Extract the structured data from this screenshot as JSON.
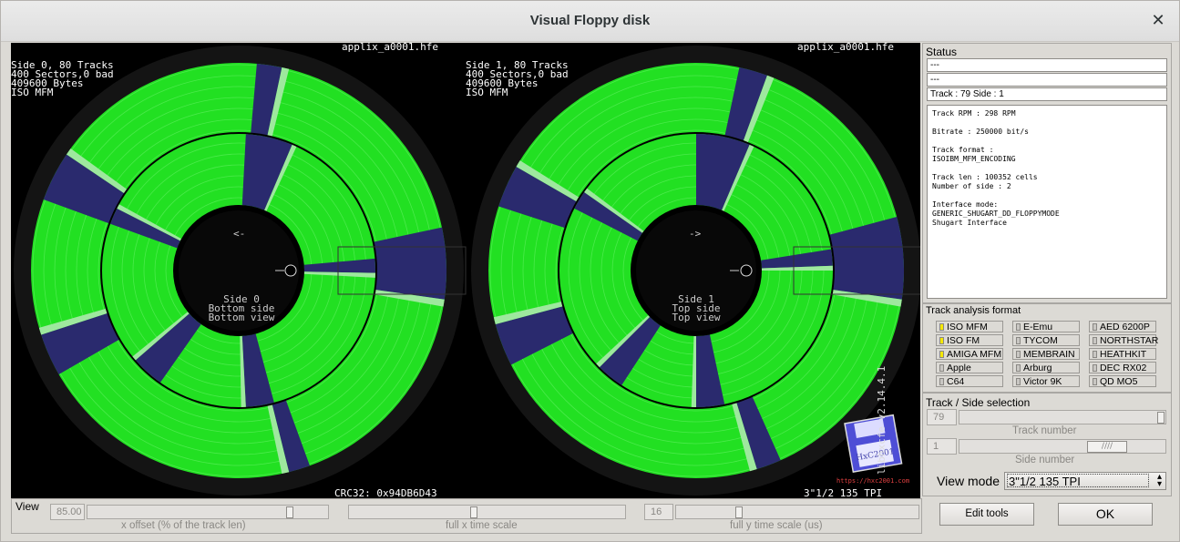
{
  "window": {
    "title": "Visual Floppy disk"
  },
  "side0": {
    "info": [
      "Side 0, 80 Tracks",
      "400 Sectors,0 bad",
      "409600 Bytes",
      "ISO MFM"
    ],
    "filename": "applix_a0001.hfe",
    "arrow": "<-",
    "center": [
      "Side 0",
      "Bottom side",
      "Bottom view"
    ]
  },
  "side1": {
    "info": [
      "Side 1, 80 Tracks",
      "400 Sectors,0 bad",
      "409600 Bytes",
      "ISO MFM"
    ],
    "filename": "applix_a0001.hfe",
    "arrow": "->",
    "center": [
      "Side 1",
      "Top side",
      "Top view"
    ]
  },
  "footer": {
    "crc": "CRC32: 0x94DB6D43",
    "format": "3\"1/2 135 TPI",
    "version": "libhxcfe v2.14.4.1",
    "url": "https://hxc2001.com",
    "logo_text": "HxC2001"
  },
  "status": {
    "label": "Status",
    "line1": "---",
    "line2": "---",
    "track_side": "Track : 79 Side : 1",
    "details": "Track RPM : 298 RPM\n\nBitrate : 250000 bit/s\n\nTrack format :\nISOIBM_MFM_ENCODING\n\nTrack len : 100352 cells\nNumber of side : 2\n\nInterface mode:\nGENERIC_SHUGART_DD_FLOPPYMODE\nShugart Interface"
  },
  "analysis": {
    "label": "Track analysis format",
    "formats": [
      {
        "name": "ISO MFM",
        "on": true
      },
      {
        "name": "E-Emu",
        "on": false
      },
      {
        "name": "AED 6200P",
        "on": false
      },
      {
        "name": "ISO FM",
        "on": true
      },
      {
        "name": "TYCOM",
        "on": false
      },
      {
        "name": "NORTHSTAR",
        "on": false
      },
      {
        "name": "AMIGA MFM",
        "on": true
      },
      {
        "name": "MEMBRAIN",
        "on": false
      },
      {
        "name": "HEATHKIT",
        "on": false
      },
      {
        "name": "Apple",
        "on": false
      },
      {
        "name": "Arburg",
        "on": false
      },
      {
        "name": "DEC RX02",
        "on": false
      },
      {
        "name": "C64",
        "on": false
      },
      {
        "name": "Victor 9K",
        "on": false
      },
      {
        "name": "QD MO5",
        "on": false
      }
    ]
  },
  "selection": {
    "label": "Track / Side selection",
    "track_value": "79",
    "track_label": "Track number",
    "side_value": "1",
    "side_label": "Side number",
    "view_mode_label": "View mode",
    "view_mode_value": "3\"1/2 135 TPI"
  },
  "view": {
    "label": "View",
    "x_offset_value": "85.00",
    "x_offset_label": "x offset (% of the track len)",
    "x_scale_label": "full x time scale",
    "y_scale_value": "16",
    "y_scale_label": "full y time scale (us)",
    "x_offset_level": 0.85,
    "x_scale_level": 0.45,
    "y_scale_level": 0.25
  },
  "buttons": {
    "edit_tools": "Edit tools",
    "ok": "OK"
  },
  "colors": {
    "track_green": "#22e022",
    "sector_gap": "#2a2a6e",
    "disk_bg": "#141414"
  }
}
